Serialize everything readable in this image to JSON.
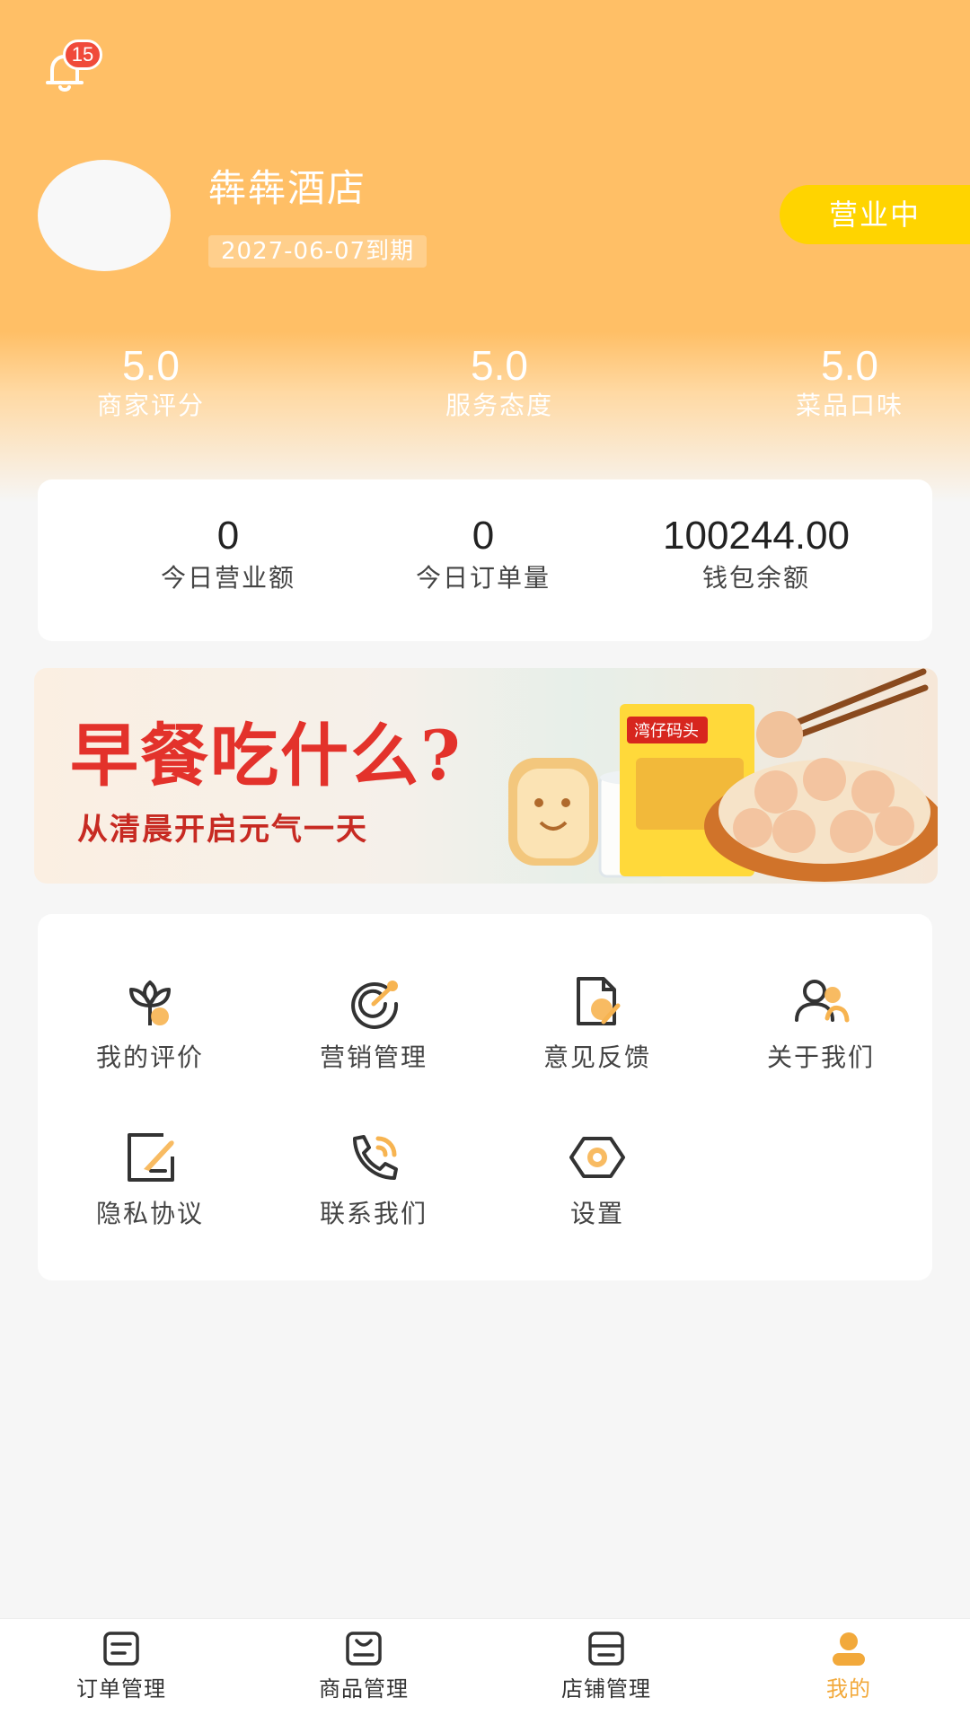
{
  "header": {
    "notification_count": "15",
    "store_name": "犇犇酒店",
    "expire_text": "2027-06-07到期",
    "status": "营业中"
  },
  "ratings": [
    {
      "value": "5.0",
      "label": "商家评分"
    },
    {
      "value": "5.0",
      "label": "服务态度"
    },
    {
      "value": "5.0",
      "label": "菜品口味"
    }
  ],
  "stats": [
    {
      "value": "0",
      "label": "今日营业额"
    },
    {
      "value": "0",
      "label": "今日订单量"
    },
    {
      "value": "100244.00",
      "label": "钱包余额"
    }
  ],
  "banner": {
    "title": "早餐吃什么?",
    "subtitle": "从清晨开启元气一天",
    "product_label": "湾仔码头"
  },
  "menu": [
    {
      "label": "我的评价",
      "icon": "flower-icon"
    },
    {
      "label": "营销管理",
      "icon": "target-icon"
    },
    {
      "label": "意见反馈",
      "icon": "feedback-doc-icon"
    },
    {
      "label": "关于我们",
      "icon": "users-icon"
    },
    {
      "label": "隐私协议",
      "icon": "privacy-doc-icon"
    },
    {
      "label": "联系我们",
      "icon": "phone-icon"
    },
    {
      "label": "设置",
      "icon": "settings-hexagon-icon"
    }
  ],
  "tabbar": [
    {
      "label": "订单管理",
      "icon": "order-icon",
      "active": false
    },
    {
      "label": "商品管理",
      "icon": "goods-icon",
      "active": false
    },
    {
      "label": "店铺管理",
      "icon": "store-icon",
      "active": false
    },
    {
      "label": "我的",
      "icon": "profile-icon",
      "active": true
    }
  ],
  "colors": {
    "header": "#ffbf66",
    "status_pill": "#ffd400",
    "accent": "#f2a93b",
    "badge": "#f04a3a",
    "banner_red": "#e3322b"
  }
}
